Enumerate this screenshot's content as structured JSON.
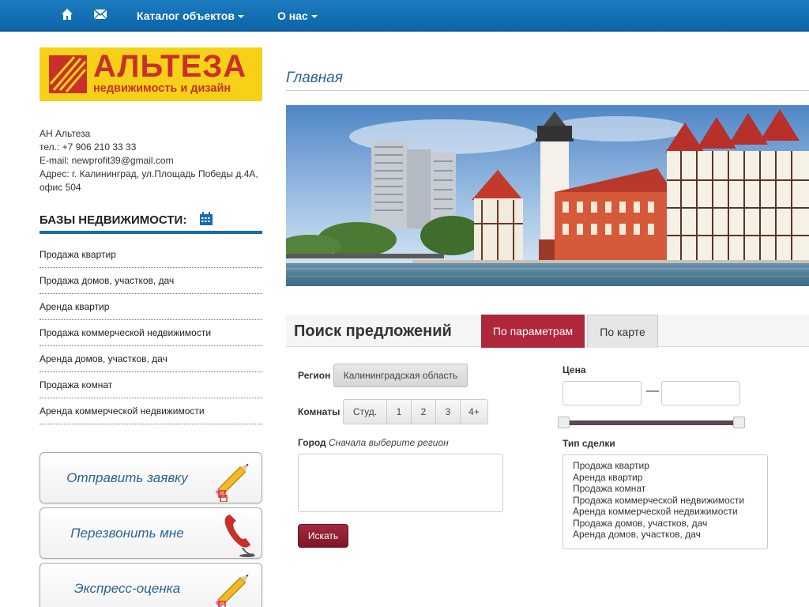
{
  "nav": {
    "home_icon": "home-icon",
    "mail_icon": "envelope-icon",
    "catalog": "Каталог объектов",
    "about": "О нас"
  },
  "logo": {
    "title": "АЛЬТЕЗА",
    "subtitle": "недвижимость и дизайн"
  },
  "contacts": {
    "name": "АН Альтеза",
    "phone": "тел.: +7 906 210 33 33",
    "email": "E-mail: newprofit39@gmail.com",
    "address_line1": "Адрес: г. Калининград, ул.Площадь Победы д.4А,",
    "address_line2": "офис 504"
  },
  "sidebar": {
    "bases_title": "БАЗЫ НЕДВИЖИМОСТИ:",
    "items": [
      {
        "label": "Продажа квартир"
      },
      {
        "label": "Продажа домов, участков, дач"
      },
      {
        "label": "Аренда квартир"
      },
      {
        "label": "Продажа коммерческой недвижимости"
      },
      {
        "label": "Аренда домов, участков, дач"
      },
      {
        "label": "Продажа комнат"
      },
      {
        "label": "Аренда коммерческой недвижимости"
      }
    ],
    "buttons": {
      "send_request": "Отправить заявку",
      "callback": "Перезвонить мне",
      "express": "Экспресс-оценка"
    }
  },
  "main": {
    "breadcrumb": "Главная",
    "search": {
      "title": "Поиск предложений",
      "tab_params": "По параметрам",
      "tab_map": "По карте",
      "region_label": "Регион",
      "region_value": "Калининградская область",
      "rooms_label": "Комнаты",
      "rooms": [
        "Студ.",
        "1",
        "2",
        "3",
        "4+"
      ],
      "city_label": "Город",
      "city_hint": "Сначала выберите регион",
      "submit": "Искать",
      "price_label": "Цена",
      "price_sep": "—",
      "deal_label": "Тип сделки",
      "deal_types": [
        "Продажа квартир",
        "Аренда квартир",
        "Продажа комнат",
        "Продажа коммерческой недвижимости",
        "Аренда коммерческой недвижимости",
        "Продажа домов, участков, дач",
        "Аренда домов, участков, дач"
      ]
    }
  },
  "colors": {
    "nav_blue": "#0c64a8",
    "accent_red": "#b0263a",
    "logo_yellow": "#f7d117",
    "link_blue": "#2a6496"
  }
}
